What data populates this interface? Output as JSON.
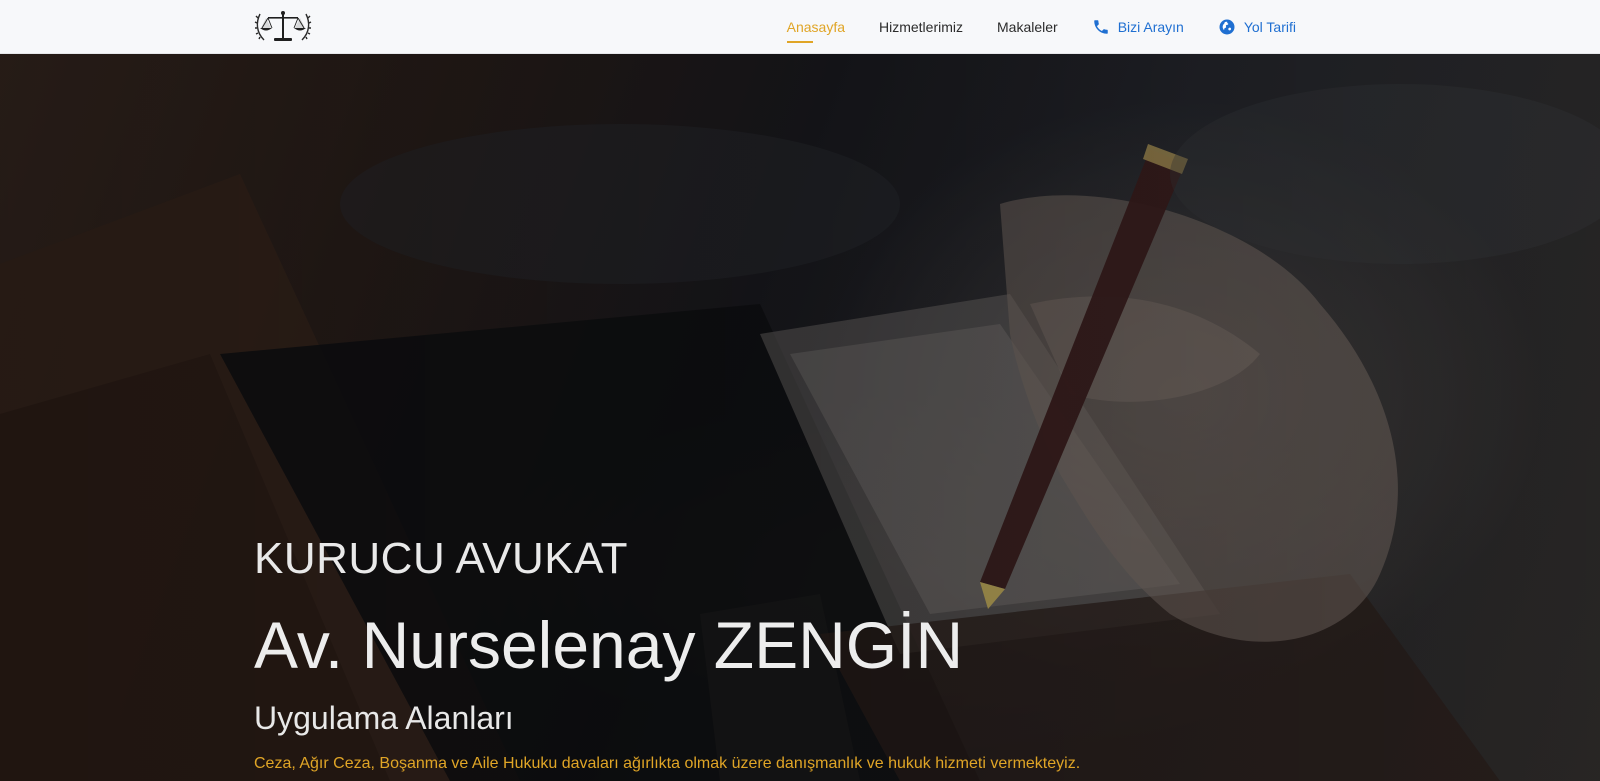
{
  "nav": {
    "logo_label": "Law scales logo",
    "items": [
      {
        "label": "Anasayfa",
        "icon": null,
        "active": true
      },
      {
        "label": "Hizmetlerimiz",
        "icon": null,
        "active": false
      },
      {
        "label": "Makaleler",
        "icon": null,
        "active": false
      },
      {
        "label": "Bizi Arayın",
        "icon": "phone-icon",
        "active": false
      },
      {
        "label": "Yol Tarifi",
        "icon": "globe-icon",
        "active": false
      }
    ]
  },
  "hero": {
    "eyebrow": "KURUCU AVUKAT",
    "name": "Av. Nurselenay ZENGİN",
    "subhead": "Uygulama Alanları",
    "description": "Ceza, Ağır Ceza, Boşanma ve Aile Hukuku davaları ağırlıkta olmak üzere danışmanlık ve hukuk hizmeti vermekteyiz."
  },
  "colors": {
    "accent": "#e0a526",
    "link_blue": "#1f6fd1",
    "navbar_bg": "#f7f8fa"
  }
}
